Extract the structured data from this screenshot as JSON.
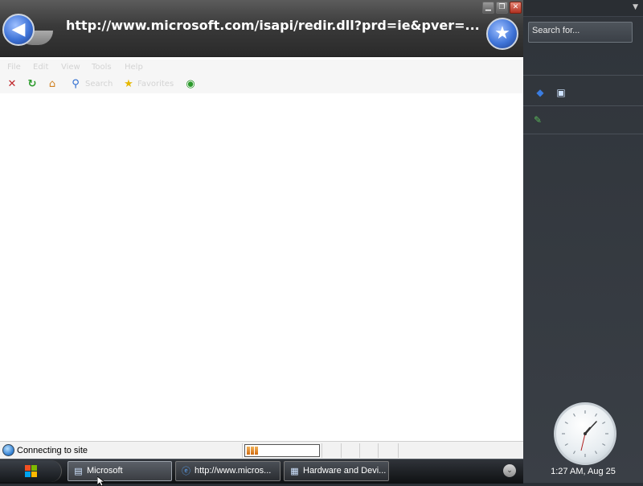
{
  "browser": {
    "url_title": "http://www.microsoft.com/isapi/redir.dll?prd=ie&pver=...",
    "window_controls": {
      "minimize_glyph": "▁",
      "restore_glyph": "❐",
      "close_glyph": "✕"
    },
    "back_glyph": "◀",
    "favorites_glyph": "★",
    "menu": [
      "File",
      "Edit",
      "View",
      "Tools",
      "Help"
    ],
    "toolbar": {
      "stop_icon": "stop-icon",
      "refresh_icon": "refresh-icon",
      "home_icon": "home-icon",
      "search_label": "Search",
      "favorites_label": "Favorites",
      "media_icon": "media-icon"
    },
    "status": {
      "text": "Connecting to site",
      "progress_fraction": 0.2
    }
  },
  "sidebar": {
    "search_placeholder": "Search for...",
    "clock_display": "1:27 AM, Aug 25"
  },
  "taskbar": {
    "tasks": [
      {
        "label": "Microsoft"
      },
      {
        "label": "http://www.micros..."
      },
      {
        "label": "Hardware and Devi..."
      }
    ]
  },
  "colors": {
    "accent_blue": "#3f74d8",
    "sidebar_bg": "#2f343a",
    "progress_orange": "#e08a2a"
  }
}
